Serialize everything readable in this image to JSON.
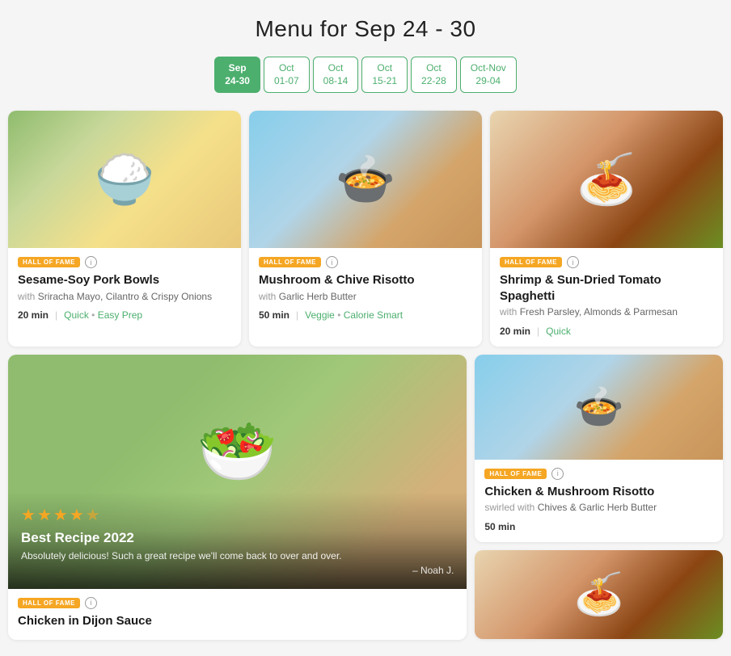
{
  "header": {
    "title": "Menu for Sep 24 - 30"
  },
  "tabs": [
    {
      "label_line1": "Sep",
      "label_line2": "24-30",
      "active": true
    },
    {
      "label_line1": "Oct",
      "label_line2": "01-07",
      "active": false
    },
    {
      "label_line1": "Oct",
      "label_line2": "08-14",
      "active": false
    },
    {
      "label_line1": "Oct",
      "label_line2": "15-21",
      "active": false
    },
    {
      "label_line1": "Oct",
      "label_line2": "22-28",
      "active": false
    },
    {
      "label_line1": "Oct-Nov",
      "label_line2": "29-04",
      "active": false
    }
  ],
  "cards": {
    "pork_bowls": {
      "badge": "HALL OF FAME",
      "title": "Sesame-Soy Pork Bowls",
      "subtitle_prefix": "with",
      "subtitle": "Sriracha Mayo, Cilantro & Crispy Onions",
      "time": "20 min",
      "tags": [
        "Quick",
        "Easy Prep"
      ],
      "tag_separator": "•"
    },
    "mushroom_risotto": {
      "badge": "HALL OF FAME",
      "title": "Mushroom & Chive Risotto",
      "subtitle_prefix": "with",
      "subtitle": "Garlic Herb Butter",
      "time": "50 min",
      "tags": [
        "Veggie",
        "Calorie Smart"
      ],
      "tag_separator": "•"
    },
    "shrimp_pasta": {
      "badge": "HALL OF FAME",
      "title": "Shrimp & Sun-Dried Tomato Spaghetti",
      "subtitle_prefix": "with",
      "subtitle": "Fresh Parsley, Almonds & Parmesan",
      "time": "20 min",
      "tags": [
        "Quick"
      ],
      "tag_separator": ""
    },
    "chicken_dijon": {
      "badge": "HALL OF FAME",
      "stars": 4.5,
      "best_recipe_label": "Best Recipe 2022",
      "review_text": "Absolutely delicious! Such a great recipe we'll come back to over and over.",
      "reviewer": "– Noah J.",
      "title": "Chicken in Dijon Sauce"
    },
    "chicken_mushroom": {
      "badge": "HALL OF FAME",
      "title": "Chicken & Mushroom Risotto",
      "subtitle_prefix": "swirled with",
      "subtitle": "Chives & Garlic Herb Butter",
      "time": "50 min",
      "tags": [],
      "tag_separator": ""
    }
  },
  "icons": {
    "info": "i",
    "star_full": "★",
    "star_half": "★"
  }
}
